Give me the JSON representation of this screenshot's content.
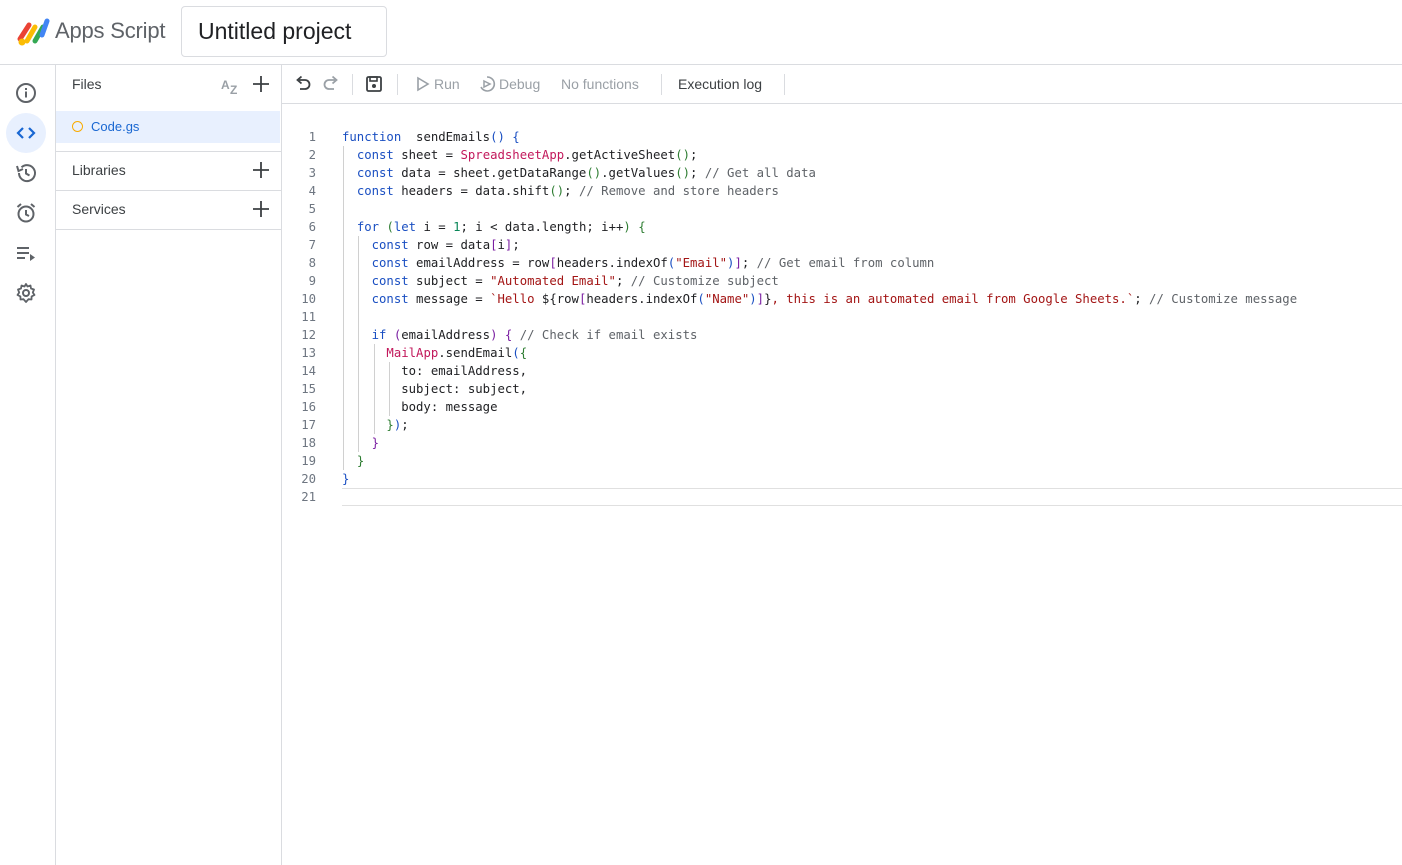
{
  "header": {
    "app_name": "Apps Script",
    "project_title": "Untitled project"
  },
  "rail": {
    "items": [
      {
        "name": "overview",
        "icon": "info-icon"
      },
      {
        "name": "editor",
        "icon": "code-icon",
        "active": true
      },
      {
        "name": "project-history",
        "icon": "history-icon"
      },
      {
        "name": "triggers",
        "icon": "alarm-icon"
      },
      {
        "name": "executions",
        "icon": "executions-icon"
      },
      {
        "name": "project-settings",
        "icon": "gear-icon"
      }
    ]
  },
  "files_panel": {
    "files_label": "Files",
    "files": [
      {
        "name": "Code.gs",
        "active": true
      }
    ],
    "libraries_label": "Libraries",
    "services_label": "Services"
  },
  "toolbar": {
    "run_label": "Run",
    "debug_label": "Debug",
    "function_select": "No functions",
    "execution_log_label": "Execution log"
  },
  "editor": {
    "lines": [
      {
        "n": "1",
        "tokens": [
          [
            "kw",
            "function"
          ],
          [
            "",
            "  sendEmails"
          ],
          [
            "br1",
            "()"
          ],
          [
            "",
            " "
          ],
          [
            "br1",
            "{"
          ]
        ]
      },
      {
        "n": "2",
        "tokens": [
          [
            "",
            "  "
          ],
          [
            "kw",
            "const"
          ],
          [
            "",
            " sheet = "
          ],
          [
            "cls",
            "SpreadsheetApp"
          ],
          [
            "",
            ".getActiveSheet"
          ],
          [
            "br2",
            "()"
          ],
          [
            "",
            ";"
          ]
        ]
      },
      {
        "n": "3",
        "tokens": [
          [
            "",
            "  "
          ],
          [
            "kw",
            "const"
          ],
          [
            "",
            " data = sheet.getDataRange"
          ],
          [
            "br2",
            "()"
          ],
          [
            "",
            ".getValues"
          ],
          [
            "br2",
            "()"
          ],
          [
            "",
            "; "
          ],
          [
            "cm",
            "// Get all data"
          ]
        ]
      },
      {
        "n": "4",
        "tokens": [
          [
            "",
            "  "
          ],
          [
            "kw",
            "const"
          ],
          [
            "",
            " headers = data.shift"
          ],
          [
            "br2",
            "()"
          ],
          [
            "",
            "; "
          ],
          [
            "cm",
            "// Remove and store headers"
          ]
        ]
      },
      {
        "n": "5",
        "tokens": []
      },
      {
        "n": "6",
        "tokens": [
          [
            "",
            "  "
          ],
          [
            "kw",
            "for"
          ],
          [
            "",
            " "
          ],
          [
            "br2",
            "("
          ],
          [
            "kw",
            "let"
          ],
          [
            "",
            " i = "
          ],
          [
            "num",
            "1"
          ],
          [
            "",
            "; i < data.length; i++"
          ],
          [
            "br2",
            ")"
          ],
          [
            "",
            " "
          ],
          [
            "br2",
            "{"
          ]
        ]
      },
      {
        "n": "7",
        "tokens": [
          [
            "",
            "    "
          ],
          [
            "kw",
            "const"
          ],
          [
            "",
            " row = data"
          ],
          [
            "br3",
            "["
          ],
          [
            "",
            "i"
          ],
          [
            "br3",
            "]"
          ],
          [
            "",
            ";"
          ]
        ]
      },
      {
        "n": "8",
        "tokens": [
          [
            "",
            "    "
          ],
          [
            "kw",
            "const"
          ],
          [
            "",
            " emailAddress = row"
          ],
          [
            "br3",
            "["
          ],
          [
            "",
            "headers.indexOf"
          ],
          [
            "br1",
            "("
          ],
          [
            "str",
            "\"Email\""
          ],
          [
            "br1",
            ")"
          ],
          [
            "br3",
            "]"
          ],
          [
            "",
            "; "
          ],
          [
            "cm",
            "// Get email from column"
          ]
        ]
      },
      {
        "n": "9",
        "tokens": [
          [
            "",
            "    "
          ],
          [
            "kw",
            "const"
          ],
          [
            "",
            " subject = "
          ],
          [
            "str",
            "\"Automated Email\""
          ],
          [
            "",
            "; "
          ],
          [
            "cm",
            "// Customize subject"
          ]
        ]
      },
      {
        "n": "10",
        "tokens": [
          [
            "",
            "    "
          ],
          [
            "kw",
            "const"
          ],
          [
            "",
            " message = "
          ],
          [
            "str",
            "`Hello "
          ],
          [
            "",
            "${row"
          ],
          [
            "br3",
            "["
          ],
          [
            "",
            "headers.indexOf"
          ],
          [
            "br1",
            "("
          ],
          [
            "str",
            "\"Name\""
          ],
          [
            "br1",
            ")"
          ],
          [
            "br3",
            "]"
          ],
          [
            "",
            "}"
          ],
          [
            "str",
            ", this is an automated email from Google Sheets.`"
          ],
          [
            "",
            "; "
          ],
          [
            "cm",
            "// Customize message"
          ]
        ]
      },
      {
        "n": "11",
        "tokens": []
      },
      {
        "n": "12",
        "tokens": [
          [
            "",
            "    "
          ],
          [
            "kw",
            "if"
          ],
          [
            "",
            " "
          ],
          [
            "br3",
            "("
          ],
          [
            "",
            "emailAddress"
          ],
          [
            "br3",
            ")"
          ],
          [
            "",
            " "
          ],
          [
            "br3",
            "{"
          ],
          [
            "",
            " "
          ],
          [
            "cm",
            "// Check if email exists"
          ]
        ]
      },
      {
        "n": "13",
        "tokens": [
          [
            "",
            "      "
          ],
          [
            "cls",
            "MailApp"
          ],
          [
            "",
            ".sendEmail"
          ],
          [
            "br1",
            "("
          ],
          [
            "br2",
            "{"
          ]
        ]
      },
      {
        "n": "14",
        "tokens": [
          [
            "",
            "        to: emailAddress,"
          ]
        ]
      },
      {
        "n": "15",
        "tokens": [
          [
            "",
            "        subject: subject,"
          ]
        ]
      },
      {
        "n": "16",
        "tokens": [
          [
            "",
            "        body: message"
          ]
        ]
      },
      {
        "n": "17",
        "tokens": [
          [
            "",
            "      "
          ],
          [
            "br2",
            "}"
          ],
          [
            "br1",
            ")"
          ],
          [
            "",
            ";"
          ]
        ]
      },
      {
        "n": "18",
        "tokens": [
          [
            "",
            "    "
          ],
          [
            "br3",
            "}"
          ]
        ]
      },
      {
        "n": "19",
        "tokens": [
          [
            "",
            "  "
          ],
          [
            "br2",
            "}"
          ]
        ]
      },
      {
        "n": "20",
        "tokens": [
          [
            "br1",
            "}"
          ]
        ]
      },
      {
        "n": "21",
        "tokens": []
      }
    ]
  },
  "colors": {
    "accent": "#1967d2",
    "active_bg": "#e8f0fe",
    "border": "#dadce0",
    "keyword": "#1a4fc2",
    "string": "#a31515",
    "class": "#c2185b",
    "comment": "#5f6368",
    "file_dot": "#f9ab00"
  }
}
